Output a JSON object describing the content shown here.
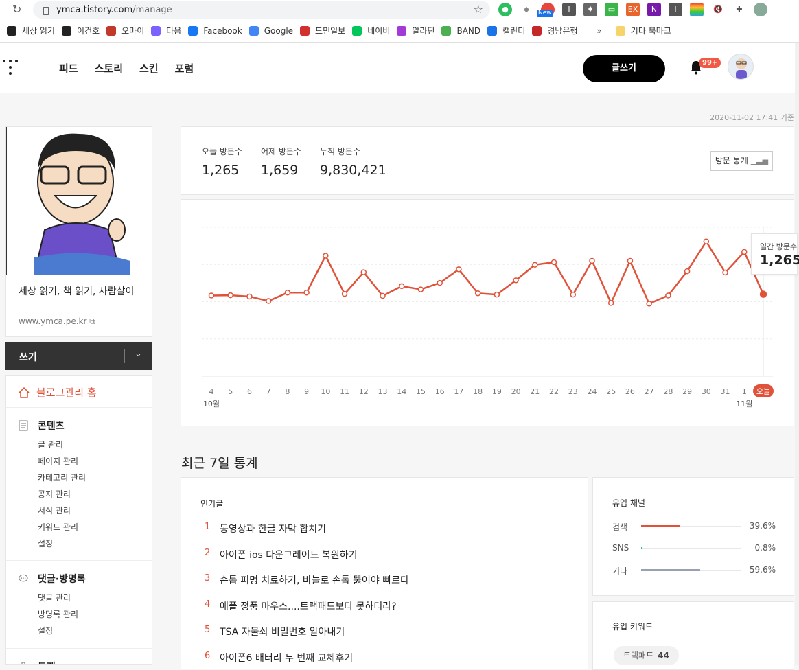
{
  "browser": {
    "url_host": "ymca.tistory.com",
    "url_path": "/manage",
    "ext_new_badge": "New",
    "bookmarks": [
      {
        "label": "세상 읽기",
        "color": "#222222"
      },
      {
        "label": "이건호",
        "color": "#222222"
      },
      {
        "label": "오마이",
        "color": "#c0392b"
      },
      {
        "label": "다음",
        "color": "#7b61ff"
      },
      {
        "label": "Facebook",
        "color": "#1877f2"
      },
      {
        "label": "Google",
        "color": "#4285f4"
      },
      {
        "label": "도민일보",
        "color": "#d32f2f"
      },
      {
        "label": "네이버",
        "color": "#03c75a"
      },
      {
        "label": "알라딘",
        "color": "#a23ad6"
      },
      {
        "label": "BAND",
        "color": "#4caf50"
      },
      {
        "label": "캘린더",
        "color": "#1a73e8"
      },
      {
        "label": "경남은행",
        "color": "#c62828"
      }
    ],
    "bookmarks_overflow": "»",
    "other_bookmarks": "기타 북마크"
  },
  "nav": {
    "links": [
      "피드",
      "스토리",
      "스킨",
      "포럼"
    ],
    "write_button": "글쓰기",
    "notification_count": "99+"
  },
  "timestamp": "2020-11-02 17:41 기준",
  "sidebar": {
    "blog_title": "세상 읽기, 책 읽기, 사람살이",
    "blog_url": "www.ymca.pe.kr",
    "write_label": "쓰기",
    "home_label": "블로그관리 홈",
    "sections": [
      {
        "title": "콘텐츠",
        "icon": "document-icon",
        "items": [
          "글 관리",
          "페이지 관리",
          "카테고리 관리",
          "공지 관리",
          "서식 관리",
          "키워드 관리",
          "설정"
        ]
      },
      {
        "title": "댓글·방명록",
        "icon": "comment-icon",
        "items": [
          "댓글 관리",
          "방명록 관리",
          "설정"
        ]
      },
      {
        "title": "통계",
        "icon": "stats-icon",
        "items": []
      }
    ]
  },
  "stats": {
    "today_label": "오늘 방문수",
    "today_value": "1,265",
    "yesterday_label": "어제 방문수",
    "yesterday_value": "1,659",
    "total_label": "누적 방문수",
    "total_value": "9,830,421",
    "visit_stats_button": "방문 통계"
  },
  "chart_data": {
    "type": "line",
    "x": [
      "4",
      "5",
      "6",
      "7",
      "8",
      "9",
      "10",
      "11",
      "12",
      "13",
      "14",
      "15",
      "16",
      "17",
      "18",
      "19",
      "20",
      "21",
      "22",
      "23",
      "24",
      "25",
      "26",
      "27",
      "28",
      "29",
      "30",
      "31",
      "1",
      "오늘"
    ],
    "month_labels": [
      {
        "at": "4",
        "label": "10월"
      },
      {
        "at": "1",
        "label": "11월"
      }
    ],
    "series": [
      {
        "values": [
          1245,
          1250,
          1230,
          1160,
          1290,
          1290,
          1860,
          1270,
          1605,
          1240,
          1390,
          1340,
          1440,
          1650,
          1280,
          1260,
          1480,
          1720,
          1760,
          1260,
          1780,
          1130,
          1780,
          1120,
          1245,
          1620,
          2080,
          1600,
          1920,
          1265
        ],
        "color": "#e0523a"
      }
    ],
    "ylim": [
      0,
      2300
    ],
    "grid": true,
    "tooltip_label": "일간 방문수",
    "tooltip_value": "1,265"
  },
  "recent": {
    "title": "최근 7일 통계",
    "popular_title": "인기글",
    "popular": [
      {
        "rank": "1",
        "title": "동영상과 한글 자막 합치기"
      },
      {
        "rank": "2",
        "title": "아이폰 ios 다운그레이드 복원하기"
      },
      {
        "rank": "3",
        "title": "손톱 피멍 치료하기, 바늘로 손톱 뚫어야 빠르다"
      },
      {
        "rank": "4",
        "title": "애플 정품 마우스....트랙패드보다 못하더라?"
      },
      {
        "rank": "5",
        "title": "TSA 자물쇠 비밀번호 알아내기"
      },
      {
        "rank": "6",
        "title": "아이폰6 배터리 두 번째 교체후기"
      }
    ],
    "channel_title": "유입 채널",
    "channels": [
      {
        "name": "검색",
        "pct": "39.6%",
        "value": 0.396,
        "color": "#e0523a"
      },
      {
        "name": "SNS",
        "pct": "0.8%",
        "value": 0.008,
        "color": "#2bbbad"
      },
      {
        "name": "기타",
        "pct": "59.6%",
        "value": 0.596,
        "color": "#9aa0b4"
      }
    ],
    "keyword_title": "유입 키워드",
    "keywords": [
      {
        "text": "트랙패드",
        "count": "44"
      }
    ]
  }
}
